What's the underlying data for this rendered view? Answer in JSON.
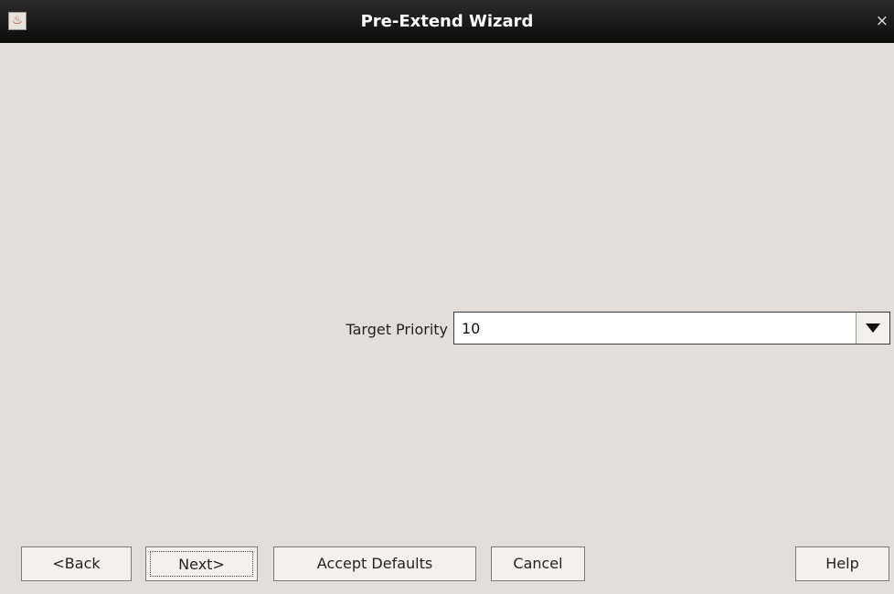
{
  "window": {
    "title": "Pre-Extend Wizard",
    "close_glyph": "×",
    "app_icon": "java-coffee-icon"
  },
  "form": {
    "target_priority_label": "Target Priority",
    "target_priority_value": "10"
  },
  "buttons": {
    "back": "<Back",
    "next": "Next>",
    "accept_defaults": "Accept Defaults",
    "cancel": "Cancel",
    "help": "Help"
  }
}
